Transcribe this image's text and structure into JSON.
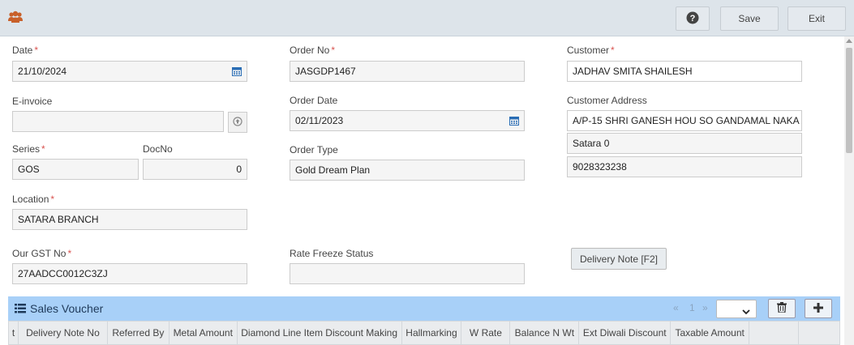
{
  "toolbar": {
    "help_icon": "question-circle-icon",
    "save_label": "Save",
    "exit_label": "Exit",
    "app_icon": "users-icon"
  },
  "form": {
    "date": {
      "label": "Date",
      "required": "*",
      "value": "21/10/2024"
    },
    "order_no": {
      "label": "Order No",
      "required": "*",
      "value": "JASGDP1467"
    },
    "customer": {
      "label": "Customer",
      "required": "*",
      "value": "JADHAV SMITA SHAILESH"
    },
    "einvoice": {
      "label": "E-invoice",
      "value": ""
    },
    "order_date": {
      "label": "Order Date",
      "value": "02/11/2023"
    },
    "customer_address": {
      "label": "Customer Address",
      "line1": "A/P-15 SHRI  GANESH HOU SO GANDAMAL NAKA",
      "line2": "Satara 0",
      "line3": "9028323238"
    },
    "series": {
      "label": "Series",
      "required": "*",
      "value": "GOS"
    },
    "docno": {
      "label": "DocNo",
      "value": "0"
    },
    "order_type": {
      "label": "Order Type",
      "value": "Gold Dream Plan"
    },
    "location": {
      "label": "Location",
      "required": "*",
      "value": "SATARA BRANCH"
    },
    "gst": {
      "label": "Our GST No",
      "required": "*",
      "value": "27AADCC0012C3ZJ"
    },
    "rate_freeze": {
      "label": "Rate Freeze Status",
      "value": ""
    },
    "delivery_note_button": "Delivery Note [F2]"
  },
  "voucher": {
    "title": "Sales Voucher",
    "pager": {
      "prev": "«",
      "page": "1",
      "next": "»"
    },
    "columns": [
      "t",
      "Delivery Note No",
      "Referred By",
      "Metal Amount",
      "Diamond Line Item Discount Making",
      "Hallmarking",
      "W Rate",
      "Balance N Wt",
      "Ext Diwali Discount",
      "Taxable Amount",
      "",
      ""
    ]
  }
}
